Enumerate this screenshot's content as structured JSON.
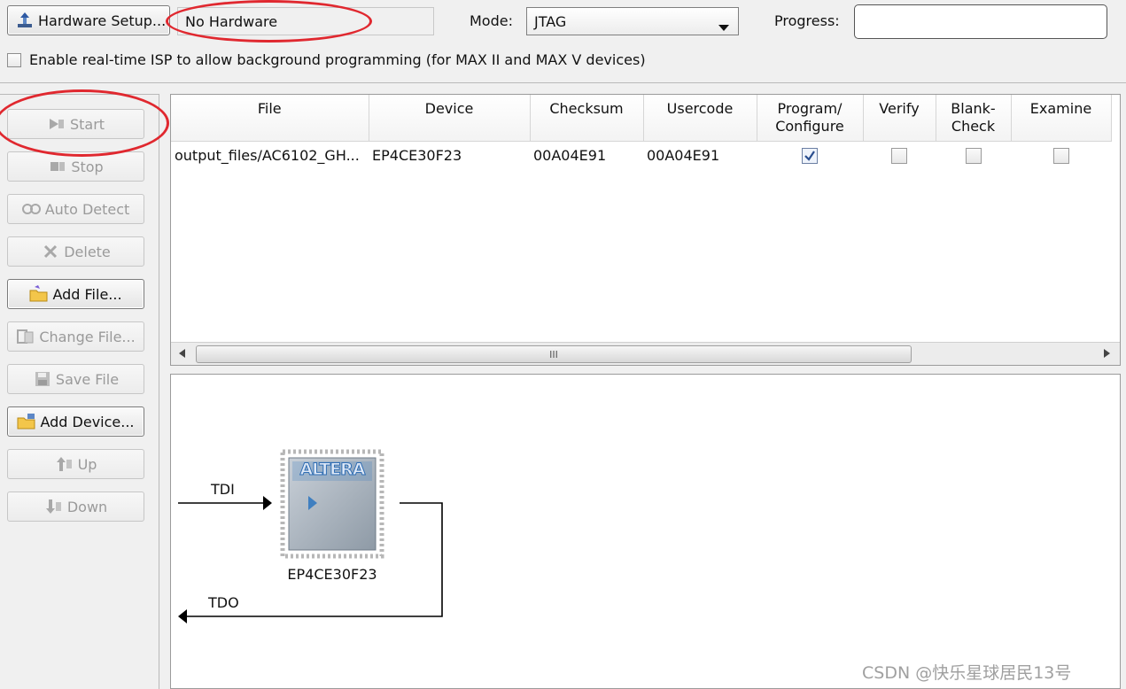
{
  "toolbar": {
    "hardware_setup_label": "Hardware Setup...",
    "hardware_value": "No Hardware",
    "mode_label": "Mode:",
    "mode_value": "JTAG",
    "progress_label": "Progress:",
    "progress_value": "",
    "isp_checkbox_label": "Enable real-time ISP to allow background programming (for MAX II and MAX V devices)",
    "isp_checked": false
  },
  "sidebar": {
    "buttons": [
      {
        "label": "Start",
        "icon": "start-icon",
        "enabled": false
      },
      {
        "label": "Stop",
        "icon": "stop-icon",
        "enabled": false
      },
      {
        "label": "Auto Detect",
        "icon": "auto-detect-icon",
        "enabled": false
      },
      {
        "label": "Delete",
        "icon": "delete-icon",
        "enabled": false
      },
      {
        "label": "Add File...",
        "icon": "add-file-icon",
        "enabled": true
      },
      {
        "label": "Change File...",
        "icon": "change-file-icon",
        "enabled": false
      },
      {
        "label": "Save File",
        "icon": "save-file-icon",
        "enabled": false
      },
      {
        "label": "Add Device...",
        "icon": "add-device-icon",
        "enabled": true
      },
      {
        "label": "Up",
        "icon": "up-icon",
        "enabled": false
      },
      {
        "label": "Down",
        "icon": "down-icon",
        "enabled": false
      }
    ]
  },
  "table": {
    "columns": [
      "File",
      "Device",
      "Checksum",
      "Usercode",
      "Program/ Configure",
      "Verify",
      "Blank- Check",
      "Examine"
    ],
    "rows": [
      {
        "file": "output_files/AC6102_GH...",
        "device": "EP4CE30F23",
        "checksum": "00A04E91",
        "usercode": "00A04E91",
        "program": true,
        "verify": false,
        "blank_check": false,
        "examine": false
      }
    ],
    "scrollbar_grip": "III"
  },
  "chain": {
    "tdi_label": "TDI",
    "tdo_label": "TDO",
    "chip_logo": "ALTERA",
    "device_name": "EP4CE30F23"
  },
  "watermark": "CSDN @快乐星球居民13号",
  "colors": {
    "annotation": "#e0282f",
    "window_bg": "#f0f0f0",
    "chip_blue": "#3f7fc0"
  }
}
